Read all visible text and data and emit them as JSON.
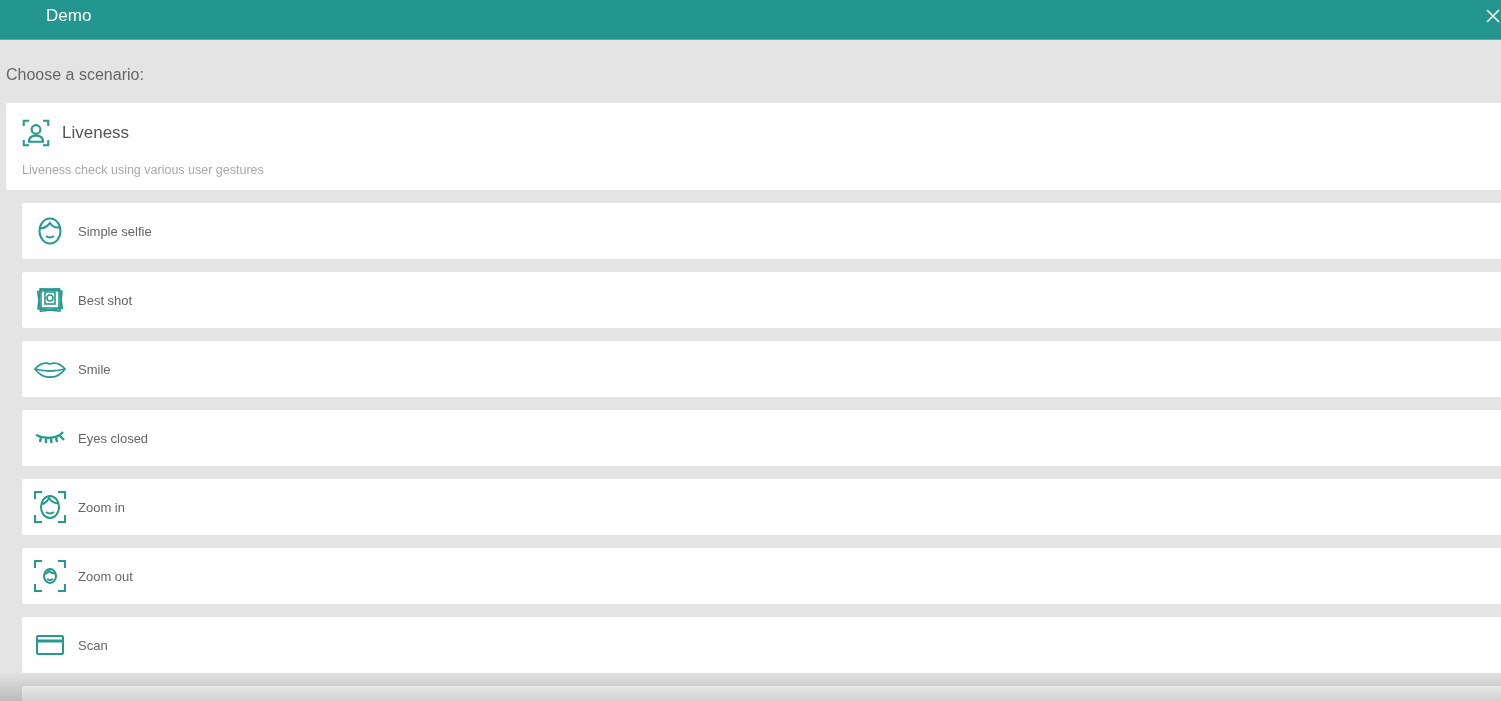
{
  "window": {
    "title": "Demo"
  },
  "prompt": "Choose a scenario:",
  "scenario": {
    "title": "Liveness",
    "description": "Liveness check using various user gestures",
    "kind": "person-scan"
  },
  "options": [
    {
      "kind": "face",
      "label": "Simple selfie"
    },
    {
      "kind": "photo-stack",
      "label": "Best shot"
    },
    {
      "kind": "lips",
      "label": "Smile"
    },
    {
      "kind": "closed-eye",
      "label": "Eyes closed"
    },
    {
      "kind": "face-scan-large",
      "label": "Zoom in"
    },
    {
      "kind": "face-scan-small",
      "label": "Zoom out"
    },
    {
      "kind": "card",
      "label": "Scan"
    },
    {
      "kind": "cut-off"
    }
  ]
}
